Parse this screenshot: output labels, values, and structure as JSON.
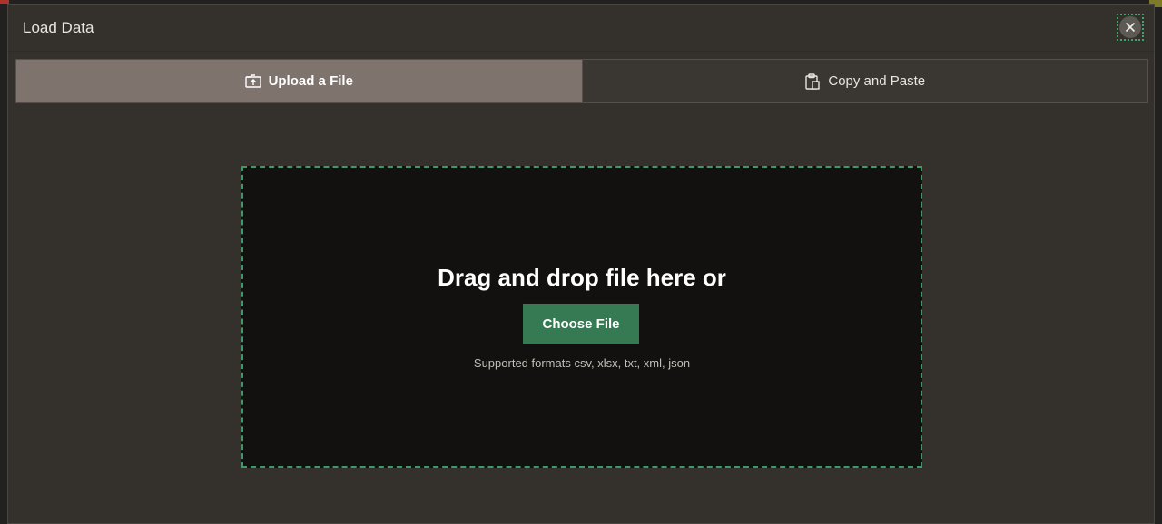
{
  "dialog": {
    "title": "Load Data",
    "close_icon": "close-icon"
  },
  "tabs": [
    {
      "label": "Upload a File",
      "icon": "upload-file-icon",
      "active": true
    },
    {
      "label": "Copy and Paste",
      "icon": "clipboard-icon",
      "active": false
    }
  ],
  "dropzone": {
    "heading": "Drag and drop file here or",
    "button_label": "Choose File",
    "formats_text": "Supported formats csv, xlsx, txt, xml, json"
  },
  "colors": {
    "accent_green": "#357a52",
    "active_tab": "#7e736d",
    "dialog_bg": "#34302c",
    "dropzone_bg": "#121110"
  }
}
